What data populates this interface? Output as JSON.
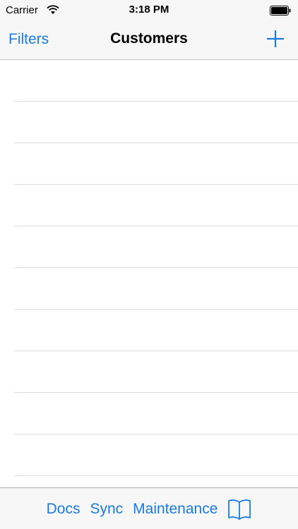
{
  "status_bar": {
    "carrier": "Carrier",
    "time": "3:18 PM",
    "wifi_icon": "wifi-icon",
    "battery_icon": "battery-icon"
  },
  "nav_bar": {
    "left_label": "Filters",
    "title": "Customers",
    "add_icon": "plus-icon"
  },
  "list": {
    "row_count": 10
  },
  "toolbar": {
    "items": [
      "Docs",
      "Sync",
      "Maintenance"
    ],
    "book_icon": "book-icon"
  },
  "colors": {
    "accent": "#1a7be6",
    "bar_background": "#f7f7f7",
    "separator": "#dcdcdc"
  }
}
